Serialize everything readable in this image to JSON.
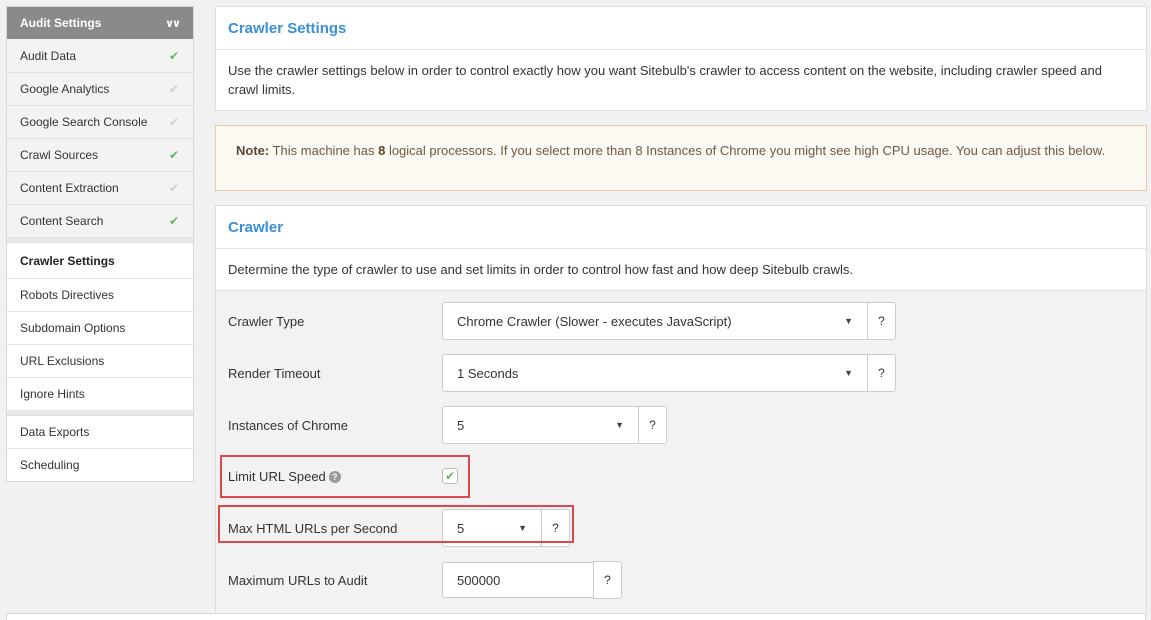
{
  "sidebar": {
    "header": "Audit Settings",
    "header_icon": "chevron-double-down-icon",
    "items": [
      {
        "label": "Audit Data",
        "status": "on"
      },
      {
        "label": "Google Analytics",
        "status": "off"
      },
      {
        "label": "Google Search Console",
        "status": "off"
      },
      {
        "label": "Crawl Sources",
        "status": "on"
      },
      {
        "label": "Content Extraction",
        "status": "off"
      },
      {
        "label": "Content Search",
        "status": "on"
      },
      {
        "label": "Crawler Settings",
        "status": "active"
      },
      {
        "label": "Robots Directives"
      },
      {
        "label": "Subdomain Options"
      },
      {
        "label": "URL Exclusions"
      },
      {
        "label": "Ignore Hints"
      },
      {
        "label": "Data Exports"
      },
      {
        "label": "Scheduling"
      }
    ],
    "check_glyph": "✔"
  },
  "settings_panel": {
    "title": "Crawler Settings",
    "description": "Use the crawler settings below in order to control exactly how you want Sitebulb's crawler to access content on the website, including crawler speed and crawl limits."
  },
  "note": {
    "label": "Note:",
    "text_1": " This machine has ",
    "processors": "8",
    "text_2": " logical processors. If you select more than 8 Instances of Chrome you might see high CPU usage. You can adjust this below."
  },
  "crawler_panel": {
    "title": "Crawler",
    "description": "Determine the type of crawler to use and set limits in order to control how fast and how deep Sitebulb crawls."
  },
  "form": {
    "crawler_type": {
      "label": "Crawler Type",
      "value": "Chrome Crawler (Slower - executes JavaScript)"
    },
    "render_timeout": {
      "label": "Render Timeout",
      "value": "1 Seconds"
    },
    "instances": {
      "label": "Instances of Chrome",
      "value": "5"
    },
    "limit_speed": {
      "label": "Limit URL Speed",
      "checked": true
    },
    "max_html": {
      "label": "Max HTML URLs per Second",
      "value": "5"
    },
    "max_urls": {
      "label": "Maximum URLs to Audit",
      "value": "500000"
    },
    "help_glyph": "?",
    "caret_glyph": "▼"
  },
  "colors": {
    "accent": "#3a8fd9",
    "check_on": "#5cb85c",
    "highlight": "#e0474c",
    "note_bg": "#fcf8f2"
  }
}
